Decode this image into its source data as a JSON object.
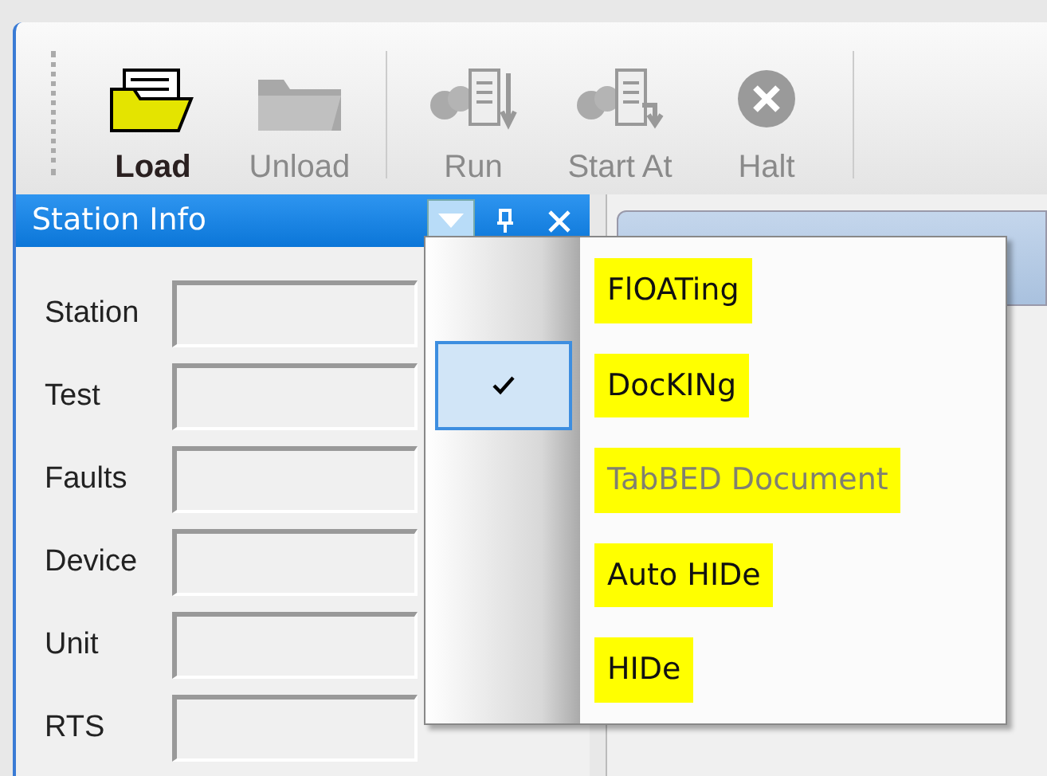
{
  "toolbar": {
    "buttons": [
      {
        "label": "Load",
        "kind": "load",
        "disabled": false
      },
      {
        "label": "Unload",
        "kind": "unload",
        "disabled": true
      },
      {
        "label": "Run",
        "kind": "run",
        "disabled": true,
        "separator_before": true
      },
      {
        "label": "Start At",
        "kind": "startat",
        "disabled": true
      },
      {
        "label": "Halt",
        "kind": "halt",
        "disabled": true
      }
    ]
  },
  "panel": {
    "title": "Station Info",
    "fields": [
      {
        "label": "Station"
      },
      {
        "label": "Test"
      },
      {
        "label": "Faults"
      },
      {
        "label": "Device"
      },
      {
        "label": "Unit"
      },
      {
        "label": "RTS"
      }
    ]
  },
  "menu": {
    "items": [
      {
        "label": "FlOATing",
        "checked": false,
        "disabled": false,
        "highlighted": true
      },
      {
        "label": "DocKINg",
        "checked": true,
        "disabled": false,
        "highlighted": true
      },
      {
        "label": "TabBED Document",
        "checked": false,
        "disabled": true,
        "highlighted": true
      },
      {
        "label": "Auto HIDe",
        "checked": false,
        "disabled": false,
        "highlighted": true
      },
      {
        "label": "HIDe",
        "checked": false,
        "disabled": false,
        "highlighted": true
      }
    ]
  }
}
